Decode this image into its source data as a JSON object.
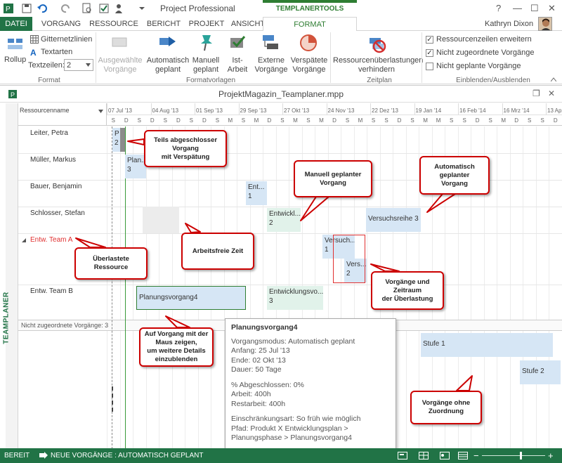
{
  "window": {
    "title": "Project Professional",
    "context_tab_title": "TEMPLANERTOOLS",
    "help": "?",
    "minimize": "—",
    "maximize": "☐",
    "close": "✕"
  },
  "tabs": [
    "DATEI",
    "VORGANG",
    "RESSOURCE",
    "BERICHT",
    "PROJEKT",
    "ANSICHT",
    "FORMAT"
  ],
  "user": {
    "name": "Kathryn Dixon"
  },
  "ribbon": {
    "format_group": {
      "label": "Format",
      "rollup": "Rollup",
      "gridlines": "Gitternetzlinien",
      "textstyles": "Textarten",
      "textlines_label": "Textzeilen:",
      "textlines_value": "2"
    },
    "formatvorlagen": {
      "label": "Formatvorlagen",
      "selected": "Ausgewählte\nVorgänge",
      "auto": "Automatisch\ngeplant",
      "manual": "Manuell\ngeplant",
      "actual": "Ist-\nArbeit",
      "external": "Externe\nVorgänge",
      "late": "Verspätete\nVorgänge"
    },
    "zeitplan": {
      "label": "Zeitplan",
      "resolve": "Ressourcenüberlastungen\nverhindern"
    },
    "show_hide": {
      "label": "Einblenden/Ausblenden",
      "opt1": "Ressourcenzeilen erweitern",
      "opt2": "Nicht zugeordnete Vorgänge",
      "opt3": "Nicht geplante Vorgänge",
      "opt1_checked": true,
      "opt2_checked": true,
      "opt3_checked": false
    }
  },
  "document": {
    "title": "ProjektMagazin_Teamplaner.mpp",
    "side_tab": "TEAMPLANER",
    "resource_column": "Ressourcenname",
    "unassigned_label": "Nicht zugeordnete Vorgänge: 3"
  },
  "timeline": {
    "dates": [
      "07 Jul '13",
      "04 Aug '13",
      "01 Sep '13",
      "29 Sep '13",
      "27 Okt '13",
      "24 Nov '13",
      "22 Dez '13",
      "19 Jan '14",
      "16 Feb '14",
      "16 Mrz '14",
      "13 Ap"
    ],
    "days": [
      "S",
      "D",
      "S",
      "D",
      "S",
      "D",
      "S",
      "D",
      "S",
      "M",
      "S",
      "M",
      "D",
      "S",
      "M",
      "S",
      "M",
      "D",
      "S",
      "M",
      "S",
      "S",
      "D",
      "S",
      "M",
      "M",
      "S",
      "S",
      "D",
      "S",
      "M",
      "D",
      "S",
      "S",
      "D"
    ]
  },
  "resources": [
    "Leiter, Petra",
    "Müller, Markus",
    "Bauer, Benjamin",
    "Schlosser, Stefan",
    "Entw. Team A",
    "Entw. Team B"
  ],
  "bars": {
    "leiter": {
      "name": "P",
      "num": "2"
    },
    "mueller": {
      "name": "Plan...",
      "num": "3"
    },
    "bauer": {
      "name": "Ent...",
      "num": "1"
    },
    "schlosser1": {
      "name": "Entwickl...",
      "num": "2"
    },
    "schlosser2": {
      "name": "Versuchsreihe 3"
    },
    "teamA1": {
      "name": "Versuch...",
      "num": "1"
    },
    "teamA2": {
      "name": "Vers...",
      "num": "2"
    },
    "teamB1": {
      "name": "Planungsvorgang4"
    },
    "teamB2": {
      "name": "Entwicklungsvo...",
      "num": "3"
    },
    "stufe1": {
      "name": "Stufe 1"
    },
    "stufe2": {
      "name": "Stufe 2"
    }
  },
  "callouts": {
    "c1": "Teils abgeschlosser Vorgang\nmit Verspätung",
    "c2": "Manuell geplanter\nVorgang",
    "c3": "Automatisch\ngeplanter\nVorgang",
    "c4": "Überlastete\nRessource",
    "c5": "Arbeitsfreie Zeit",
    "c6": "Vorgänge und\nZeitraum\nder Überlastung",
    "c7": "Auf Vorgang mit der\nMaus zeigen,\num weitere Details\neinzublenden",
    "c8": "Vorgänge ohne\nZuordnung"
  },
  "tooltip": {
    "title": "Planungsvorgang4",
    "mode": "Vorgangsmodus: Automatisch geplant",
    "start": "Anfang: 25 Jul '13",
    "end": "Ende: 02 Okt '13",
    "duration": "Dauer: 50 Tage",
    "complete": "% Abgeschlossen: 0%",
    "work": "Arbeit: 400h",
    "remaining": "Restarbeit: 400h",
    "constraint": "Einschränkungsart: So früh wie möglich",
    "path": "Pfad: Produkt X Entwicklungsplan >\nPlanungsphase > Planungsvorgang4"
  },
  "status": {
    "ready": "BEREIT",
    "new_tasks": "NEUE VORGÄNGE : AUTOMATISCH GEPLANT"
  },
  "colors": {
    "accent": "#217346",
    "callout_border": "#cc0000",
    "overallocated": "#e03030"
  }
}
